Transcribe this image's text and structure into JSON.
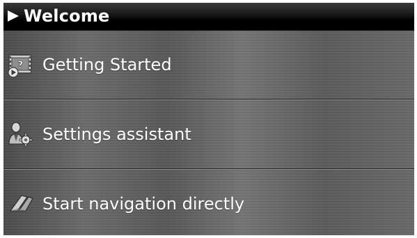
{
  "header": {
    "title": "Welcome",
    "arrow_icon": "triangle-right-icon"
  },
  "menu": {
    "items": [
      {
        "label": "Getting Started",
        "icon": "film-question-icon"
      },
      {
        "label": "Settings assistant",
        "icon": "person-gear-icon"
      },
      {
        "label": "Start navigation directly",
        "icon": "navigation-arrow-icon"
      }
    ]
  },
  "colors": {
    "title_bar": "#000000",
    "text": "#ffffff",
    "background": "#5f5f5f"
  }
}
